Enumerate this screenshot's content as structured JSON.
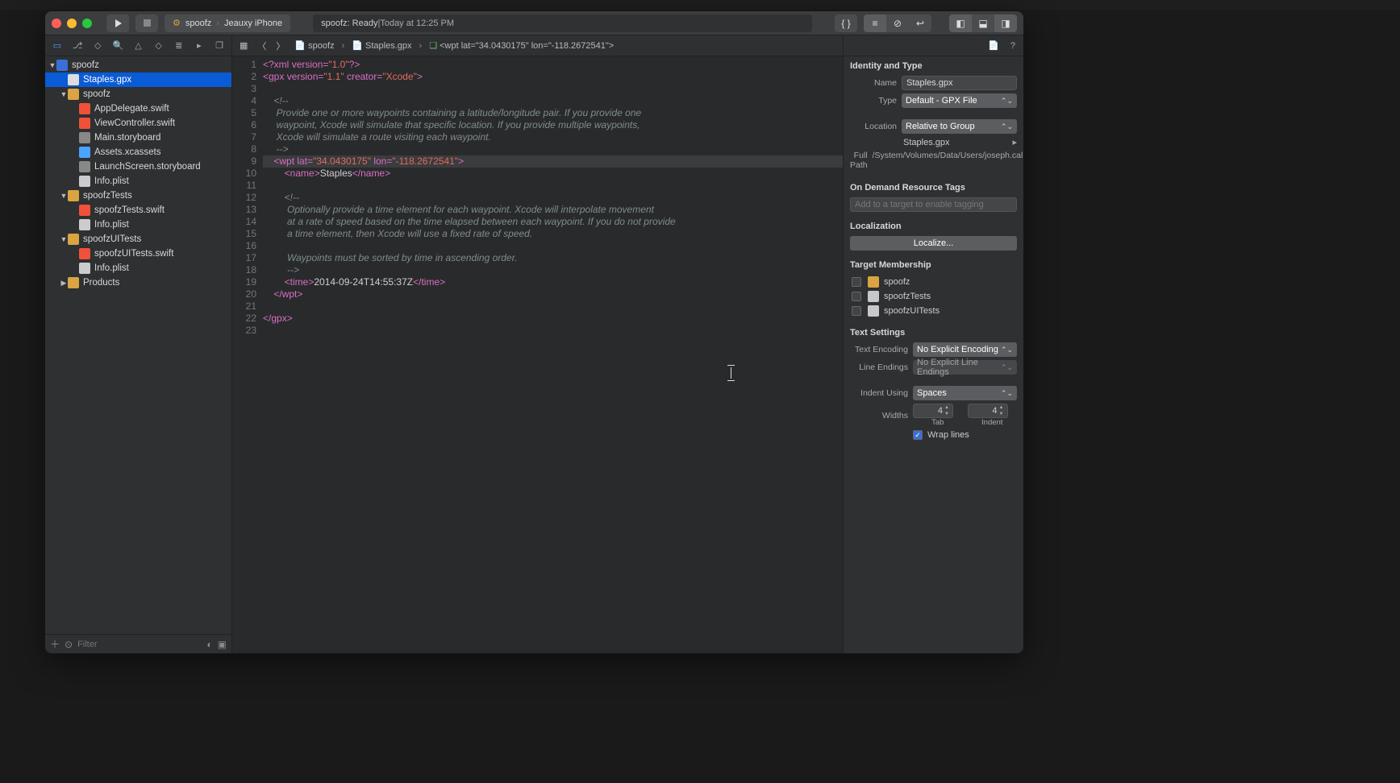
{
  "toolbar": {
    "scheme_target": "spoofz",
    "scheme_device": "Jeauxy iPhone",
    "status_project": "spoofz:",
    "status_state": "Ready",
    "status_sep": " | ",
    "status_time": "Today at 12:25 PM"
  },
  "navigator": {
    "filter_placeholder": "Filter",
    "tree": [
      {
        "indent": 0,
        "disc": "▼",
        "icon": "prj",
        "label": "spoofz"
      },
      {
        "indent": 1,
        "disc": "  ",
        "icon": "doc",
        "label": "Staples.gpx",
        "sel": true
      },
      {
        "indent": 1,
        "disc": "▼",
        "icon": "fldy",
        "label": "spoofz"
      },
      {
        "indent": 2,
        "disc": "  ",
        "icon": "sw",
        "label": "AppDelegate.swift"
      },
      {
        "indent": 2,
        "disc": "  ",
        "icon": "sw",
        "label": "ViewController.swift"
      },
      {
        "indent": 2,
        "disc": "  ",
        "icon": "sb",
        "label": "Main.storyboard"
      },
      {
        "indent": 2,
        "disc": "  ",
        "icon": "fld",
        "label": "Assets.xcassets"
      },
      {
        "indent": 2,
        "disc": "  ",
        "icon": "sb",
        "label": "LaunchScreen.storyboard"
      },
      {
        "indent": 2,
        "disc": "  ",
        "icon": "pl",
        "label": "Info.plist"
      },
      {
        "indent": 1,
        "disc": "▼",
        "icon": "fldy",
        "label": "spoofzTests"
      },
      {
        "indent": 2,
        "disc": "  ",
        "icon": "sw",
        "label": "spoofzTests.swift"
      },
      {
        "indent": 2,
        "disc": "  ",
        "icon": "pl",
        "label": "Info.plist"
      },
      {
        "indent": 1,
        "disc": "▼",
        "icon": "fldy",
        "label": "spoofzUITests"
      },
      {
        "indent": 2,
        "disc": "  ",
        "icon": "sw",
        "label": "spoofzUITests.swift"
      },
      {
        "indent": 2,
        "disc": "  ",
        "icon": "pl",
        "label": "Info.plist"
      },
      {
        "indent": 1,
        "disc": "▶",
        "icon": "fldy",
        "label": "Products"
      }
    ]
  },
  "jumpbar": {
    "items": [
      "spoofz",
      "Staples.gpx",
      "wpt lat=\"34.0430175\" lon=\"-118.2672541\""
    ]
  },
  "code": {
    "lines": [
      {
        "n": 1,
        "html": "<span class='t-tag'>&lt;?xml</span> <span class='t-attr'>version=</span><span class='t-str'>\"1.0\"</span><span class='t-tag'>?&gt;</span>"
      },
      {
        "n": 2,
        "html": "<span class='t-tag'>&lt;gpx</span> <span class='t-attr'>version=</span><span class='t-str'>\"1.1\"</span> <span class='t-attr'>creator=</span><span class='t-str'>\"Xcode\"</span><span class='t-tag'>&gt;</span>"
      },
      {
        "n": 3,
        "html": ""
      },
      {
        "n": 4,
        "html": "    <span class='t-cmt'>&lt;!--</span>"
      },
      {
        "n": 5,
        "html": "<span class='t-cmt'>     Provide one or more waypoints containing a latitude/longitude pair. If you provide one</span>"
      },
      {
        "n": 6,
        "html": "<span class='t-cmt'>     waypoint, Xcode will simulate that specific location. If you provide multiple waypoints,</span>"
      },
      {
        "n": 7,
        "html": "<span class='t-cmt'>     Xcode will simulate a route visiting each waypoint.</span>"
      },
      {
        "n": 8,
        "html": "<span class='t-cmt'>     --&gt;</span>"
      },
      {
        "n": 9,
        "hl": true,
        "html": "    <span class='t-tag'>&lt;wpt</span> <span class='t-attr'>lat=</span><span class='t-str'>\"34.0430175\"</span> <span class='t-attr'>lon=</span><span class='t-str'>\"-118.2672541\"</span><span class='t-tag'>&gt;</span>"
      },
      {
        "n": 10,
        "html": "        <span class='t-tag'>&lt;name&gt;</span><span class='t-txt'>Staples</span><span class='t-tag'>&lt;/name&gt;</span>"
      },
      {
        "n": 11,
        "html": ""
      },
      {
        "n": 12,
        "html": "        <span class='t-cmt'>&lt;!--</span>"
      },
      {
        "n": 13,
        "html": "<span class='t-cmt'>         Optionally provide a time element for each waypoint. Xcode will interpolate movement</span>"
      },
      {
        "n": 14,
        "html": "<span class='t-cmt'>         at a rate of speed based on the time elapsed between each waypoint. If you do not provide</span>"
      },
      {
        "n": 15,
        "html": "<span class='t-cmt'>         a time element, then Xcode will use a fixed rate of speed.</span>"
      },
      {
        "n": 16,
        "html": ""
      },
      {
        "n": 17,
        "html": "<span class='t-cmt'>         Waypoints must be sorted by time in ascending order.</span>"
      },
      {
        "n": 18,
        "html": "<span class='t-cmt'>         --&gt;</span>"
      },
      {
        "n": 19,
        "html": "        <span class='t-tag'>&lt;time&gt;</span><span class='t-txt'>2014-09-24T14:55:37Z</span><span class='t-tag'>&lt;/time&gt;</span>"
      },
      {
        "n": 20,
        "html": "    <span class='t-tag'>&lt;/wpt&gt;</span>"
      },
      {
        "n": 21,
        "html": ""
      },
      {
        "n": 22,
        "html": "<span class='t-tag'>&lt;/gpx&gt;</span>"
      },
      {
        "n": 23,
        "html": ""
      }
    ]
  },
  "inspector": {
    "identity_title": "Identity and Type",
    "name_label": "Name",
    "name_value": "Staples.gpx",
    "type_label": "Type",
    "type_value": "Default - GPX File",
    "location_label": "Location",
    "location_value": "Relative to Group",
    "location_file": "Staples.gpx",
    "fullpath_label": "Full Path",
    "fullpath_value": "/System/Volumes/Data/Users/joseph.callaway/Desktop/spoofz/Staples.gpx",
    "odr_title": "On Demand Resource Tags",
    "odr_placeholder": "Add to a target to enable tagging",
    "loc_title": "Localization",
    "loc_button": "Localize...",
    "target_title": "Target Membership",
    "targets": [
      {
        "checked": false,
        "icon": "#d9a441",
        "label": "spoofz"
      },
      {
        "checked": false,
        "icon": "#c8c8c8",
        "label": "spoofzTests"
      },
      {
        "checked": false,
        "icon": "#c8c8c8",
        "label": "spoofzUITests"
      }
    ],
    "ts_title": "Text Settings",
    "enc_label": "Text Encoding",
    "enc_value": "No Explicit Encoding",
    "le_label": "Line Endings",
    "le_value": "No Explicit Line Endings",
    "iu_label": "Indent Using",
    "iu_value": "Spaces",
    "widths_label": "Widths",
    "tab_value": "4",
    "indent_value": "4",
    "tab_sub": "Tab",
    "indent_sub": "Indent",
    "wrap_label": "Wrap lines",
    "wrap_checked": true
  }
}
